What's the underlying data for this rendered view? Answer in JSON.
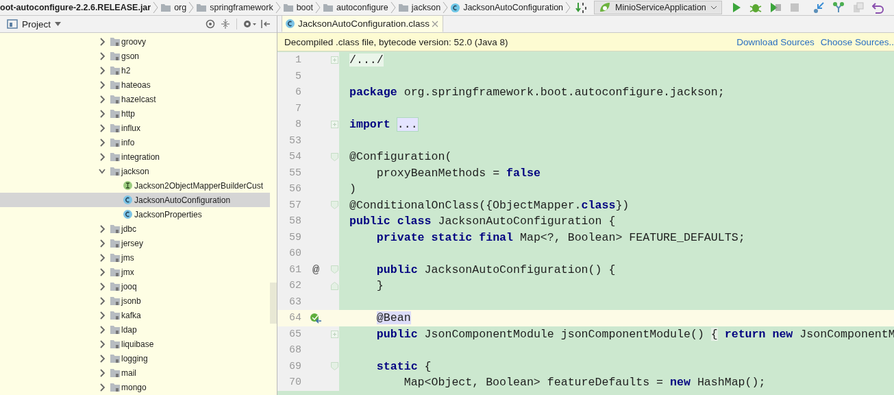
{
  "breadcrumbs": [
    {
      "label": "oot-autoconfigure-2.2.6.RELEASE.jar",
      "kind": "jar"
    },
    {
      "label": "org",
      "kind": "folder"
    },
    {
      "label": "springframework",
      "kind": "folder"
    },
    {
      "label": "boot",
      "kind": "folder"
    },
    {
      "label": "autoconfigure",
      "kind": "folder"
    },
    {
      "label": "jackson",
      "kind": "folder"
    },
    {
      "label": "JacksonAutoConfiguration",
      "kind": "class"
    }
  ],
  "run_config": {
    "label": "MinioServiceApplication"
  },
  "project_panel": {
    "title": "Project"
  },
  "tree": {
    "items": [
      {
        "label": "groovy",
        "kind": "folder",
        "expanded": false,
        "selected": false
      },
      {
        "label": "gson",
        "kind": "folder",
        "expanded": false,
        "selected": false
      },
      {
        "label": "h2",
        "kind": "folder",
        "expanded": false,
        "selected": false
      },
      {
        "label": "hateoas",
        "kind": "folder",
        "expanded": false,
        "selected": false
      },
      {
        "label": "hazelcast",
        "kind": "folder",
        "expanded": false,
        "selected": false
      },
      {
        "label": "http",
        "kind": "folder",
        "expanded": false,
        "selected": false
      },
      {
        "label": "influx",
        "kind": "folder",
        "expanded": false,
        "selected": false
      },
      {
        "label": "info",
        "kind": "folder",
        "expanded": false,
        "selected": false
      },
      {
        "label": "integration",
        "kind": "folder",
        "expanded": false,
        "selected": false
      },
      {
        "label": "jackson",
        "kind": "folder",
        "expanded": true,
        "selected": false,
        "children": [
          {
            "label": "Jackson2ObjectMapperBuilderCust",
            "kind": "interface",
            "selected": false
          },
          {
            "label": "JacksonAutoConfiguration",
            "kind": "class",
            "selected": true
          },
          {
            "label": "JacksonProperties",
            "kind": "class",
            "selected": false
          }
        ]
      },
      {
        "label": "jdbc",
        "kind": "folder",
        "expanded": false,
        "selected": false
      },
      {
        "label": "jersey",
        "kind": "folder",
        "expanded": false,
        "selected": false
      },
      {
        "label": "jms",
        "kind": "folder",
        "expanded": false,
        "selected": false
      },
      {
        "label": "jmx",
        "kind": "folder",
        "expanded": false,
        "selected": false
      },
      {
        "label": "jooq",
        "kind": "folder",
        "expanded": false,
        "selected": false
      },
      {
        "label": "jsonb",
        "kind": "folder",
        "expanded": false,
        "selected": false
      },
      {
        "label": "kafka",
        "kind": "folder",
        "expanded": false,
        "selected": false
      },
      {
        "label": "ldap",
        "kind": "folder",
        "expanded": false,
        "selected": false
      },
      {
        "label": "liquibase",
        "kind": "folder",
        "expanded": false,
        "selected": false
      },
      {
        "label": "logging",
        "kind": "folder",
        "expanded": false,
        "selected": false
      },
      {
        "label": "mail",
        "kind": "folder",
        "expanded": false,
        "selected": false
      },
      {
        "label": "mongo",
        "kind": "folder",
        "expanded": false,
        "selected": false
      }
    ]
  },
  "editor_tabs": [
    {
      "label": "JacksonAutoConfiguration.class",
      "selected": true
    }
  ],
  "notice": {
    "text": "Decompiled .class file, bytecode version: 52.0 (Java 8)",
    "links": [
      "Download Sources",
      "Choose Sources.."
    ]
  },
  "code": {
    "lines": [
      {
        "number": "1",
        "current": false,
        "fold_marker": {
          "kind": "collapsed"
        },
        "tokens": [
          {
            "text": "/.../",
            "kind": "region"
          }
        ]
      },
      {
        "number": "5",
        "current": false
      },
      {
        "number": "6",
        "current": false,
        "tokens": [
          {
            "text": "package",
            "kind": "kw"
          },
          {
            "text": " org.springframework.boot.autoconfigure.jackson;",
            "kind": "plain"
          }
        ]
      },
      {
        "number": "7",
        "current": false
      },
      {
        "number": "8",
        "current": false,
        "fold_marker": {
          "kind": "collapsed"
        },
        "tokens": [
          {
            "text": "import",
            "kind": "kw"
          },
          {
            "text": " ...",
            "kind": "folded"
          }
        ]
      },
      {
        "number": "53",
        "current": false
      },
      {
        "number": "54",
        "current": false,
        "fold_marker": {
          "kind": "start"
        },
        "tokens": [
          {
            "text": "@Configuration(",
            "kind": "plain"
          }
        ]
      },
      {
        "number": "55",
        "current": false,
        "tokens": [
          {
            "text": "    proxyBeanMethods = ",
            "kind": "plain"
          },
          {
            "text": "false",
            "kind": "kw"
          }
        ]
      },
      {
        "number": "56",
        "current": false,
        "tokens": [
          {
            "text": ")",
            "kind": "plain"
          }
        ]
      },
      {
        "number": "57",
        "current": false,
        "fold_marker": {
          "kind": "start"
        },
        "tokens": [
          {
            "text": "@ConditionalOnClass({ObjectMapper.",
            "kind": "plain"
          },
          {
            "text": "class",
            "kind": "kw"
          },
          {
            "text": "})",
            "kind": "plain"
          }
        ]
      },
      {
        "number": "58",
        "current": false,
        "tokens": [
          {
            "text": "public class",
            "kind": "kw"
          },
          {
            "text": " JacksonAutoConfiguration {",
            "kind": "plain"
          }
        ]
      },
      {
        "number": "59",
        "current": false,
        "tokens": [
          {
            "text": "    private static final",
            "kind": "kw"
          },
          {
            "text": " Map<?, Boolean> FEATURE_DEFAULTS;",
            "kind": "plain"
          }
        ]
      },
      {
        "number": "60",
        "current": false
      },
      {
        "number": "61",
        "current": false,
        "fold_marker": {
          "kind": "start"
        },
        "gutter": {
          "kind": "symbol",
          "text": "@"
        },
        "tokens": [
          {
            "text": "    public",
            "kind": "kw"
          },
          {
            "text": " JacksonAutoConfiguration() {",
            "kind": "plain"
          }
        ]
      },
      {
        "number": "62",
        "current": false,
        "fold_marker": {
          "kind": "end"
        },
        "tokens": [
          {
            "text": "    }",
            "kind": "plain"
          }
        ]
      },
      {
        "number": "63",
        "current": false
      },
      {
        "number": "64",
        "current": true,
        "gutter": {
          "kind": "bean"
        },
        "tokens": [
          {
            "text": "    @Bean",
            "kind": "usage"
          }
        ]
      },
      {
        "number": "65",
        "current": false,
        "fold_marker": {
          "kind": "collapsed"
        },
        "tokens": [
          {
            "text": "    public",
            "kind": "kw"
          },
          {
            "text": " JsonComponentModule jsonComponentModule() ",
            "kind": "plain"
          },
          {
            "text": "{",
            "kind": "brace"
          },
          {
            "text": " return new",
            "kind": "kw"
          },
          {
            "text": " JsonComponentM",
            "kind": "plain"
          }
        ]
      },
      {
        "number": "68",
        "current": false
      },
      {
        "number": "69",
        "current": false,
        "fold_marker": {
          "kind": "start"
        },
        "tokens": [
          {
            "text": "    static",
            "kind": "kw"
          },
          {
            "text": " {",
            "kind": "plain"
          }
        ]
      },
      {
        "number": "70",
        "current": false,
        "tokens": [
          {
            "text": "        Map<Object, Boolean> featureDefaults = ",
            "kind": "plain"
          },
          {
            "text": "new",
            "kind": "kw"
          },
          {
            "text": " HashMap();",
            "kind": "plain"
          }
        ]
      }
    ]
  }
}
